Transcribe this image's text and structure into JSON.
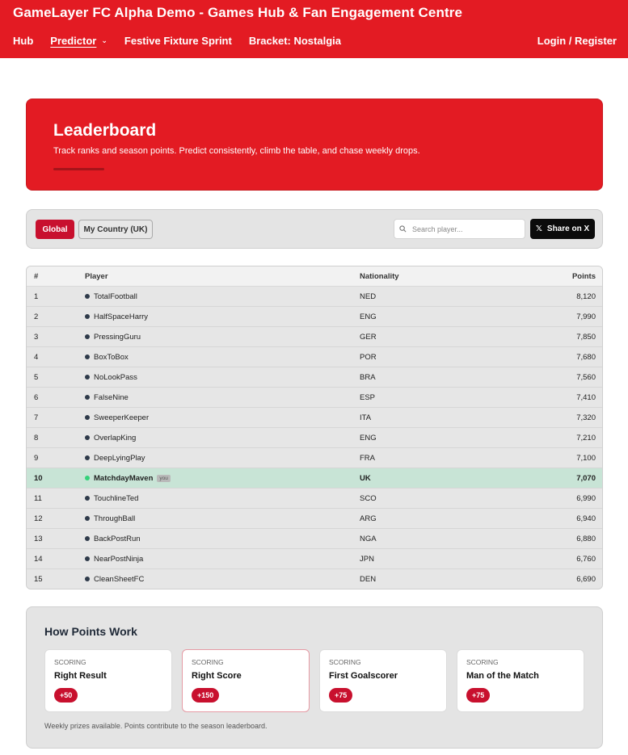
{
  "header": {
    "title": "GameLayer FC Alpha Demo - Games Hub & Fan Engagement Centre",
    "nav": [
      {
        "label": "Hub"
      },
      {
        "label": "Predictor"
      },
      {
        "label": "Festive Fixture Sprint"
      },
      {
        "label": "Bracket: Nostalgia"
      }
    ],
    "login": "Login / Register"
  },
  "hero": {
    "title": "Leaderboard",
    "subtitle": "Track ranks and season points. Predict consistently, climb the table, and chase weekly drops."
  },
  "filters": {
    "global": "Global",
    "country": "My Country (UK)",
    "search_placeholder": "Search player...",
    "share": "Share on X",
    "share_glyph": "𝕏"
  },
  "table": {
    "headers": {
      "rank": "#",
      "player": "Player",
      "nationality": "Nationality",
      "points": "Points"
    },
    "you_badge": "you",
    "rows": [
      {
        "rank": "1",
        "player": "TotalFootball",
        "nat": "NED",
        "pts": "8,120"
      },
      {
        "rank": "2",
        "player": "HalfSpaceHarry",
        "nat": "ENG",
        "pts": "7,990"
      },
      {
        "rank": "3",
        "player": "PressingGuru",
        "nat": "GER",
        "pts": "7,850"
      },
      {
        "rank": "4",
        "player": "BoxToBox",
        "nat": "POR",
        "pts": "7,680"
      },
      {
        "rank": "5",
        "player": "NoLookPass",
        "nat": "BRA",
        "pts": "7,560"
      },
      {
        "rank": "6",
        "player": "FalseNine",
        "nat": "ESP",
        "pts": "7,410"
      },
      {
        "rank": "7",
        "player": "SweeperKeeper",
        "nat": "ITA",
        "pts": "7,320"
      },
      {
        "rank": "8",
        "player": "OverlapKing",
        "nat": "ENG",
        "pts": "7,210"
      },
      {
        "rank": "9",
        "player": "DeepLyingPlay",
        "nat": "FRA",
        "pts": "7,100"
      },
      {
        "rank": "10",
        "player": "MatchdayMaven",
        "nat": "UK",
        "pts": "7,070"
      },
      {
        "rank": "11",
        "player": "TouchlineTed",
        "nat": "SCO",
        "pts": "6,990"
      },
      {
        "rank": "12",
        "player": "ThroughBall",
        "nat": "ARG",
        "pts": "6,940"
      },
      {
        "rank": "13",
        "player": "BackPostRun",
        "nat": "NGA",
        "pts": "6,880"
      },
      {
        "rank": "14",
        "player": "NearPostNinja",
        "nat": "JPN",
        "pts": "6,760"
      },
      {
        "rank": "15",
        "player": "CleanSheetFC",
        "nat": "DEN",
        "pts": "6,690"
      }
    ]
  },
  "points": {
    "title": "How Points Work",
    "cards": [
      {
        "kicker": "SCORING",
        "name": "Right Result",
        "value": "+50"
      },
      {
        "kicker": "SCORING",
        "name": "Right Score",
        "value": "+150"
      },
      {
        "kicker": "SCORING",
        "name": "First Goalscorer",
        "value": "+75"
      },
      {
        "kicker": "SCORING",
        "name": "Man of the Match",
        "value": "+75"
      }
    ],
    "footnote": "Weekly prizes available. Points contribute to the season leaderboard."
  },
  "colors": {
    "brand": "#e31b23",
    "accent": "#c8102e",
    "highlight_row": "#c8e4d6"
  }
}
